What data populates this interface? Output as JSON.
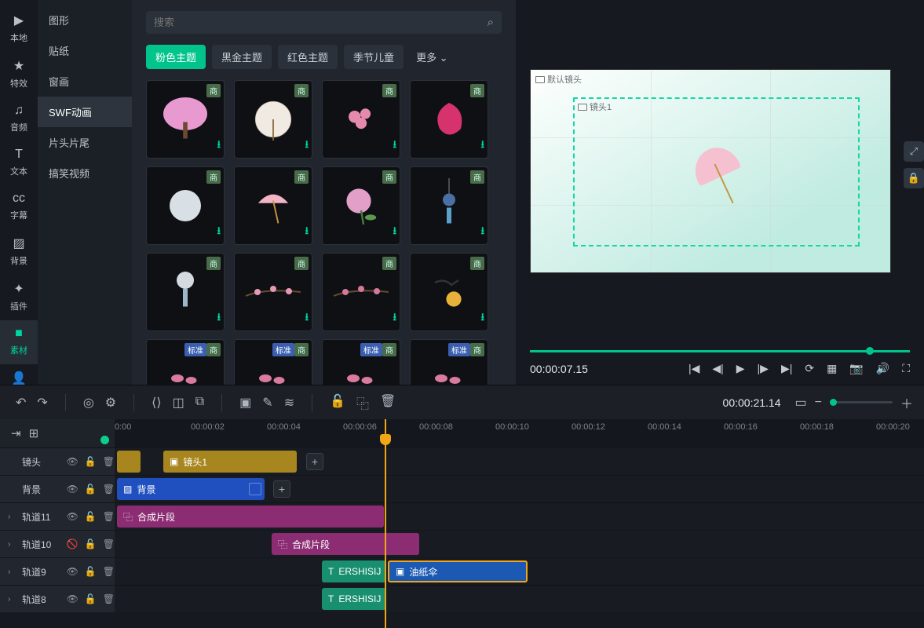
{
  "leftNav": [
    {
      "label": "本地",
      "icon": "▶"
    },
    {
      "label": "特效",
      "icon": "★"
    },
    {
      "label": "音频",
      "icon": "♫"
    },
    {
      "label": "文本",
      "icon": "T"
    },
    {
      "label": "字幕",
      "icon": "cc"
    },
    {
      "label": "背景",
      "icon": "▨"
    },
    {
      "label": "插件",
      "icon": "✦"
    },
    {
      "label": "素材",
      "icon": "■",
      "active": true
    },
    {
      "label": "角色",
      "icon": "👤"
    }
  ],
  "subNav": [
    "图形",
    "贴纸",
    "窗画",
    "SWF动画",
    "片头片尾",
    "搞笑视频"
  ],
  "subNavActive": "SWF动画",
  "searchPlaceholder": "搜索",
  "filters": [
    "粉色主题",
    "黑金主题",
    "红色主题",
    "季节儿童"
  ],
  "filterActive": "粉色主题",
  "filterMore": "更多",
  "assets": [
    {
      "badge": "商",
      "dl": true,
      "shape": "tree",
      "color": "#e89ad0"
    },
    {
      "badge": "商",
      "dl": true,
      "shape": "fan"
    },
    {
      "badge": "商",
      "dl": true,
      "shape": "blob",
      "color": "#e58aac"
    },
    {
      "badge": "商",
      "dl": true,
      "shape": "pink",
      "color": "#d6336c"
    },
    {
      "badge": "商",
      "dl": true,
      "shape": "circle",
      "color": "#d9e0e5"
    },
    {
      "badge": "商",
      "dl": true,
      "shape": "umbrella",
      "color": "#f2b4c6"
    },
    {
      "badge": "商",
      "dl": true,
      "shape": "hydra",
      "color": "#e2a0c8"
    },
    {
      "badge": "商",
      "dl": true,
      "shape": "charm",
      "color": "#4a6fa3"
    },
    {
      "badge": "商",
      "dl": true,
      "shape": "bell",
      "color": "#d4dae0"
    },
    {
      "badge": "商",
      "dl": true,
      "shape": "branch",
      "color": "#e49ab3"
    },
    {
      "badge": "商",
      "dl": true,
      "shape": "branch2",
      "color": "#d37a9a"
    },
    {
      "badge": "商",
      "dl": true,
      "shape": "bird",
      "color": "#e8b23a"
    },
    {
      "badge": "商",
      "badge2": "标准",
      "dl": false,
      "shape": "petal",
      "color": "#da7a9e"
    },
    {
      "badge": "商",
      "badge2": "标准",
      "dl": false,
      "shape": "petal",
      "color": "#da7a9e"
    },
    {
      "badge": "商",
      "badge2": "标准",
      "dl": false,
      "shape": "petal",
      "color": "#da7a9e"
    },
    {
      "badge": "商",
      "badge2": "标准",
      "dl": false,
      "shape": "petal",
      "color": "#da7a9e"
    }
  ],
  "preview": {
    "camDefaultLabel": "默认镜头",
    "camInnerLabel": "镜头1",
    "currentTime": "00:00:07.15"
  },
  "toolbar": {
    "timelineTime": "00:00:21.14"
  },
  "ruler": [
    "0:00",
    "00:00:02",
    "00:00:04",
    "00:00:06",
    "00:00:08",
    "00:00:10",
    "00:00:12",
    "00:00:14",
    "00:00:16",
    "00:00:18",
    "00:00:20"
  ],
  "tracks": {
    "cam": {
      "name": "镜头"
    },
    "bg": {
      "name": "背景"
    },
    "t11": {
      "name": "轨道11"
    },
    "t10": {
      "name": "轨道10"
    },
    "t9": {
      "name": "轨道9"
    },
    "t8": {
      "name": "轨道8"
    }
  },
  "clips": {
    "camClip": "镜头1",
    "bgClip": "背景",
    "comp": "合成片段",
    "ershi": "ERSHISIJ",
    "umbrella": "油纸伞"
  }
}
